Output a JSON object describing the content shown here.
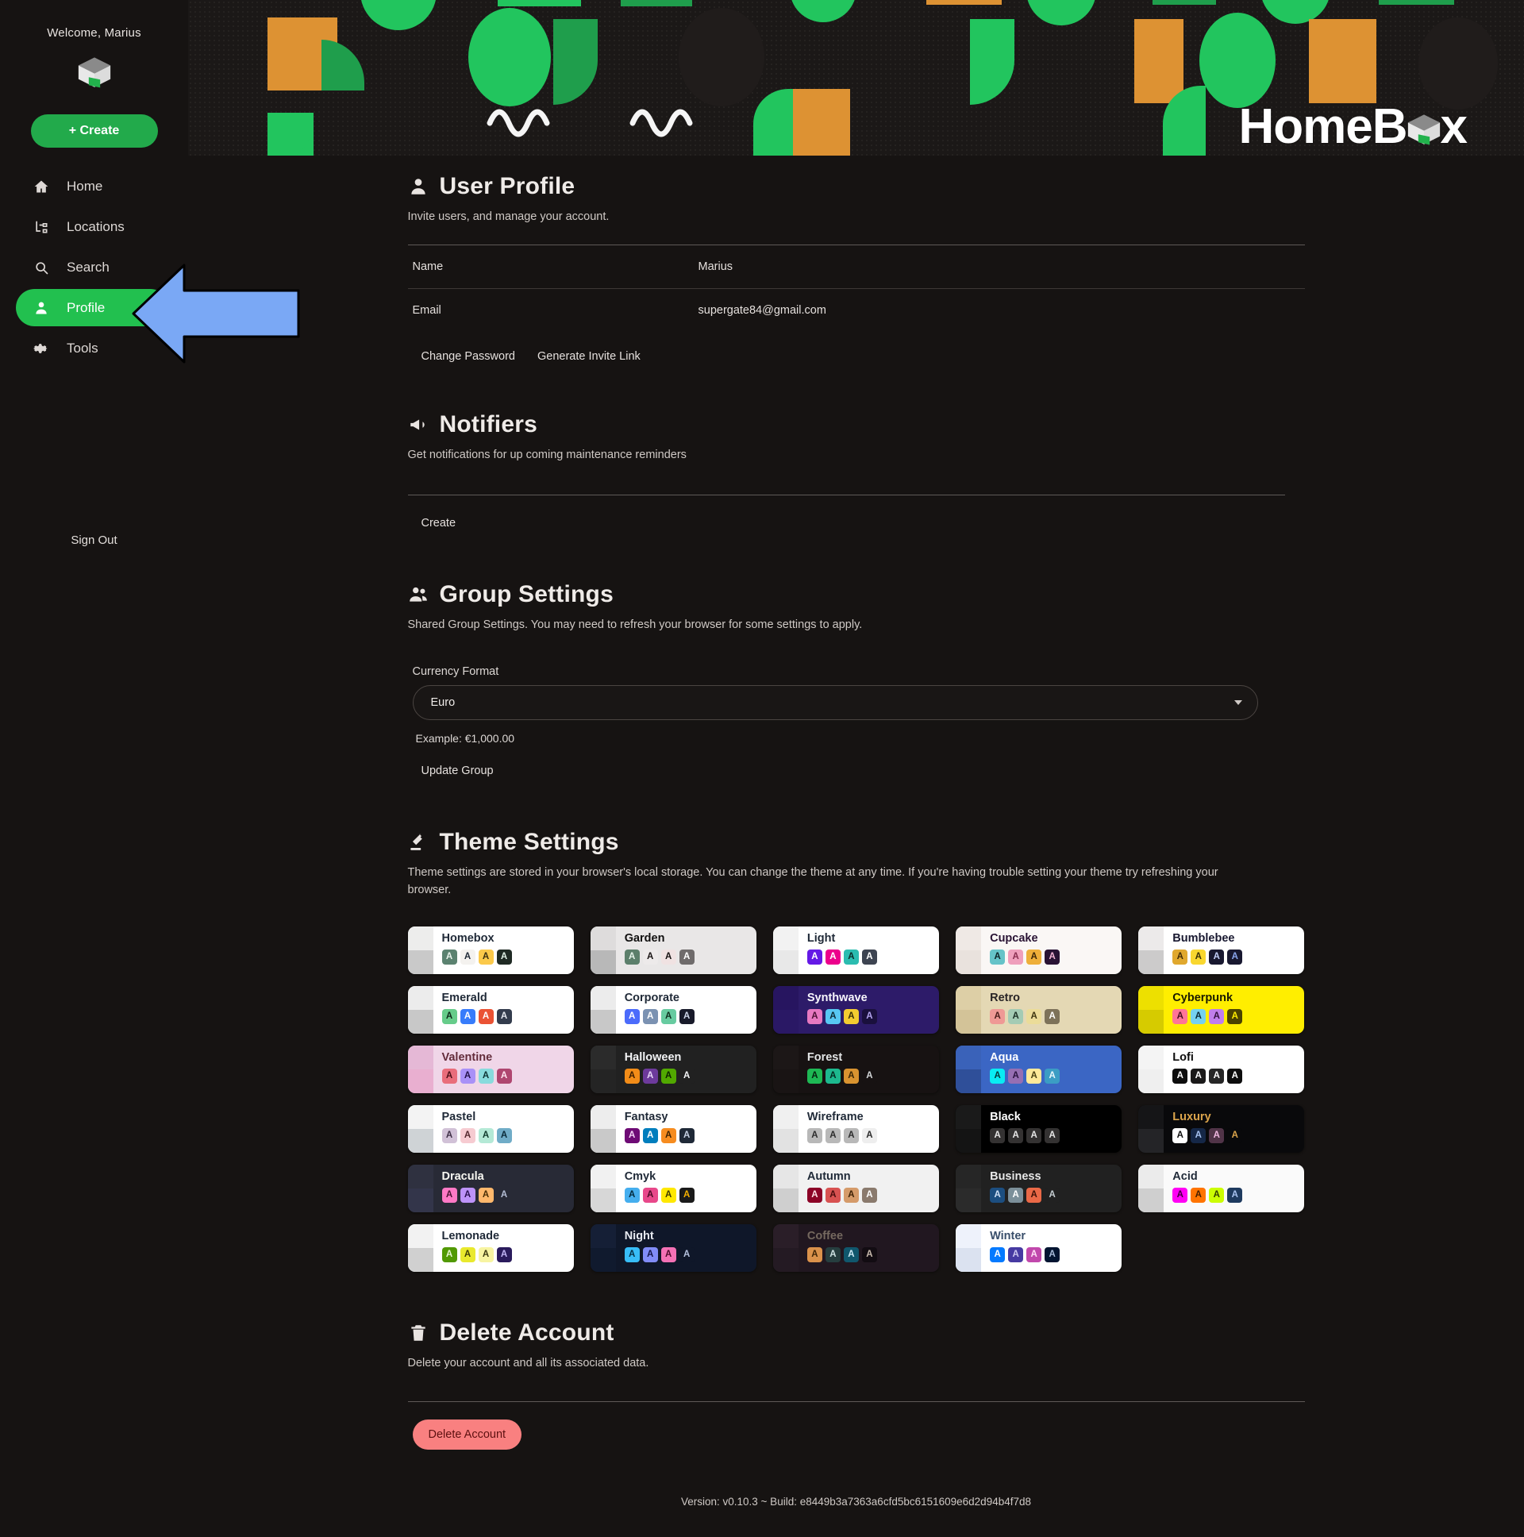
{
  "app": {
    "logo_text_left": "HomeB",
    "logo_text_right": "x",
    "logo_icon": "box-icon"
  },
  "sidebar": {
    "welcome": "Welcome, Marius",
    "brand_icon": "homebox-box-icon",
    "create_label": "+ Create",
    "items": [
      {
        "label": "Home",
        "icon": "home-icon",
        "active": false
      },
      {
        "label": "Locations",
        "icon": "locations-tree-icon",
        "active": false
      },
      {
        "label": "Search",
        "icon": "search-icon",
        "active": false
      },
      {
        "label": "Profile",
        "icon": "person-icon",
        "active": true
      },
      {
        "label": "Tools",
        "icon": "gear-icon",
        "active": false
      }
    ],
    "sign_out": "Sign Out"
  },
  "annotation": {
    "arrow_color": "#7aa8f5",
    "points_to": "Profile"
  },
  "user_profile": {
    "title": "User Profile",
    "icon": "person-icon",
    "subtitle": "Invite users, and manage your account.",
    "rows": [
      {
        "key": "Name",
        "value": "Marius"
      },
      {
        "key": "Email",
        "value": "supergate84@gmail.com"
      }
    ],
    "buttons": [
      "Change Password",
      "Generate Invite Link"
    ]
  },
  "notifiers": {
    "title": "Notifiers",
    "icon": "megaphone-icon",
    "subtitle": "Get notifications for up coming maintenance reminders",
    "create_label": "Create"
  },
  "group_settings": {
    "title": "Group Settings",
    "icon": "people-icon",
    "subtitle": "Shared Group Settings. You may need to refresh your browser for some settings to apply.",
    "currency_label": "Currency Format",
    "currency_value": "Euro",
    "currency_options": [
      "Euro"
    ],
    "example": "Example: €1,000.00",
    "update_label": "Update Group"
  },
  "theme_settings": {
    "title": "Theme Settings",
    "icon": "paint-dropper-icon",
    "subtitle": "Theme settings are stored in your browser's local storage. You can change the theme at any time. If you're having trouble setting your theme try refreshing your browser.",
    "swatch_letter": "A",
    "themes": [
      {
        "name": "Homebox",
        "bg": "#ffffff",
        "strip_top": "#ededec",
        "strip_bottom": "#c9c9c9",
        "text": "#1f2937",
        "swatches": [
          [
            "#5b8270",
            "#e8f3ec"
          ],
          [
            "#f4f2ef",
            "#1f2937"
          ],
          [
            "#fbc94a",
            "#3b3011"
          ],
          [
            "#1f2a24",
            "#dff0e5"
          ]
        ]
      },
      {
        "name": "Garden",
        "bg": "#e9e7e7",
        "strip_top": "#dedcdc",
        "strip_bottom": "#b8b8b8",
        "text": "#100f0f",
        "swatches": [
          [
            "#5c7f6b",
            "#e6f3ea"
          ],
          [
            "#edeaea",
            "#171212"
          ],
          [
            "#f0e2e2",
            "#171212"
          ],
          [
            "#6f6b6b",
            "#ffffff"
          ]
        ]
      },
      {
        "name": "Light",
        "bg": "#ffffff",
        "strip_top": "#f2f2f2",
        "strip_bottom": "#e8e8e8",
        "text": "#1f2937",
        "swatches": [
          [
            "#6419e6",
            "#ffffff"
          ],
          [
            "#ec008c",
            "#ffffff"
          ],
          [
            "#2bbcb0",
            "#0d2b28"
          ],
          [
            "#3d4451",
            "#ffffff"
          ]
        ]
      },
      {
        "name": "Cupcake",
        "bg": "#faf7f5",
        "strip_top": "#efe9e5",
        "strip_bottom": "#e9e2dd",
        "text": "#291334",
        "swatches": [
          [
            "#65c3c8",
            "#0d2427"
          ],
          [
            "#ef9fbc",
            "#8a2e50"
          ],
          [
            "#eeaf3a",
            "#3a2608"
          ],
          [
            "#291334",
            "#f5b6d6"
          ]
        ]
      },
      {
        "name": "Bumblebee",
        "bg": "#ffffff",
        "strip_top": "#eceaea",
        "strip_bottom": "#cccbcb",
        "text": "#181830",
        "swatches": [
          [
            "#e0a82e",
            "#412c07"
          ],
          [
            "#f9d72f",
            "#3a3107"
          ],
          [
            "#181830",
            "#c3cffa"
          ],
          [
            "#181830",
            "#8ba7f0"
          ]
        ]
      },
      {
        "name": "Emerald",
        "bg": "#ffffff",
        "strip_top": "#ececec",
        "strip_bottom": "#c8c8c8",
        "text": "#1f2937",
        "swatches": [
          [
            "#66cc8a",
            "#0f2a1a"
          ],
          [
            "#377cfb",
            "#ffffff"
          ],
          [
            "#ea5234",
            "#ffffff"
          ],
          [
            "#333c4d",
            "#e4e7ee"
          ]
        ]
      },
      {
        "name": "Corporate",
        "bg": "#ffffff",
        "strip_top": "#ececec",
        "strip_bottom": "#c8c8c8",
        "text": "#1f2937",
        "swatches": [
          [
            "#4b6bfb",
            "#ffffff"
          ],
          [
            "#7b92b2",
            "#ffffff"
          ],
          [
            "#67cba0",
            "#10301f"
          ],
          [
            "#181a2a",
            "#cfd6ea"
          ]
        ]
      },
      {
        "name": "Synthwave",
        "bg": "#2d1b69",
        "strip_top": "#271560",
        "strip_bottom": "#2a1865",
        "text": "#f9f7fd",
        "swatches": [
          [
            "#e779c1",
            "#4b1034"
          ],
          [
            "#58c7f3",
            "#0e2a36"
          ],
          [
            "#f3cc30",
            "#3a3007"
          ],
          [
            "#1a103d",
            "#b3a4ef"
          ]
        ]
      },
      {
        "name": "Retro",
        "bg": "#e4d8b4",
        "strip_top": "#ddcfa6",
        "strip_bottom": "#d3c398",
        "text": "#282425",
        "swatches": [
          [
            "#ef9995",
            "#4a1c1a"
          ],
          [
            "#a4cbb4",
            "#1c3026"
          ],
          [
            "#ebdc99",
            "#3c3410"
          ],
          [
            "#7d7259",
            "#ffffff"
          ]
        ]
      },
      {
        "name": "Cyberpunk",
        "bg": "#ffee00",
        "strip_top": "#ede000",
        "strip_bottom": "#d6cb00",
        "text": "#1a1a00",
        "swatches": [
          [
            "#ff7598",
            "#4a0f22"
          ],
          [
            "#75d1f0",
            "#0b2b38"
          ],
          [
            "#c07eec",
            "#33113f"
          ],
          [
            "#4a4200",
            "#ffee00"
          ]
        ]
      },
      {
        "name": "Valentine",
        "bg": "#f0d6e8",
        "strip_top": "#e5b8d6",
        "strip_bottom": "#e9afd0",
        "text": "#632c3b",
        "swatches": [
          [
            "#e96d7b",
            "#4d1018"
          ],
          [
            "#a991f7",
            "#23114a"
          ],
          [
            "#88dbdd",
            "#0e3334"
          ],
          [
            "#af4670",
            "#ffe4ef"
          ]
        ]
      },
      {
        "name": "Halloween",
        "bg": "#212121",
        "strip_top": "#2b2b2b",
        "strip_bottom": "#242424",
        "text": "#f3f4f6",
        "swatches": [
          [
            "#f28c18",
            "#3c1d00"
          ],
          [
            "#6d3a9c",
            "#e6d6f7"
          ],
          [
            "#51a800",
            "#0e2400"
          ],
          [
            "#212121",
            "#f3f4f6"
          ]
        ]
      },
      {
        "name": "Forest",
        "bg": "#171212",
        "strip_top": "#1c1717",
        "strip_bottom": "#191414",
        "text": "#e3e5e6",
        "swatches": [
          [
            "#1eb854",
            "#04230f"
          ],
          [
            "#1db88e",
            "#042b20"
          ],
          [
            "#d99330",
            "#3b2706"
          ],
          [
            "#171212",
            "#d3d6d8"
          ]
        ]
      },
      {
        "name": "Aqua",
        "bg": "#3b66c4",
        "strip_top": "#3a62b9",
        "strip_bottom": "#2f4f99",
        "text": "#ffffff",
        "swatches": [
          [
            "#09ecf3",
            "#043a3c"
          ],
          [
            "#966fb3",
            "#2a1440"
          ],
          [
            "#ffe999",
            "#4a4012"
          ],
          [
            "#3b9dc4",
            "#e7f6fb"
          ]
        ]
      },
      {
        "name": "Lofi",
        "bg": "#ffffff",
        "strip_top": "#f4f4f4",
        "strip_bottom": "#efefef",
        "text": "#0d0d0d",
        "swatches": [
          [
            "#0d0d0d",
            "#ffffff"
          ],
          [
            "#1a1919",
            "#ffffff"
          ],
          [
            "#262626",
            "#ffffff"
          ],
          [
            "#0d0d0d",
            "#ffffff"
          ]
        ]
      },
      {
        "name": "Pastel",
        "bg": "#ffffff",
        "strip_top": "#f3f3f3",
        "strip_bottom": "#cfd3d6",
        "text": "#1f2937",
        "swatches": [
          [
            "#d1c1d7",
            "#3f2f46"
          ],
          [
            "#f6cbd1",
            "#54292f"
          ],
          [
            "#b4e9d6",
            "#103a2c"
          ],
          [
            "#70acc7",
            "#0b2a38"
          ]
        ]
      },
      {
        "name": "Fantasy",
        "bg": "#ffffff",
        "strip_top": "#ededed",
        "strip_bottom": "#c9c9c9",
        "text": "#1f2937",
        "swatches": [
          [
            "#6e0b75",
            "#f5d6f7"
          ],
          [
            "#007ebd",
            "#ffffff"
          ],
          [
            "#f68c1f",
            "#3d2203"
          ],
          [
            "#1f2937",
            "#c6d1e4"
          ]
        ]
      },
      {
        "name": "Wireframe",
        "bg": "#ffffff",
        "strip_top": "#f0f0f0",
        "strip_bottom": "#e2e2e2",
        "text": "#1f2937",
        "swatches": [
          [
            "#b8b8b8",
            "#2b2b2b"
          ],
          [
            "#b8b8b8",
            "#2b2b2b"
          ],
          [
            "#b8b8b8",
            "#2b2b2b"
          ],
          [
            "#eeeeee",
            "#2b2b2b"
          ]
        ]
      },
      {
        "name": "Black",
        "bg": "#000000",
        "strip_top": "#1a1a1a",
        "strip_bottom": "#141414",
        "text": "#ffffff",
        "swatches": [
          [
            "#343232",
            "#e7e7e7"
          ],
          [
            "#343232",
            "#e7e7e7"
          ],
          [
            "#343232",
            "#e7e7e7"
          ],
          [
            "#343232",
            "#e7e7e7"
          ]
        ]
      },
      {
        "name": "Luxury",
        "bg": "#09090b",
        "strip_top": "#151517",
        "strip_bottom": "#242427",
        "text": "#dca54c",
        "swatches": [
          [
            "#ffffff",
            "#0c0c0c"
          ],
          [
            "#152747",
            "#a7c2f0"
          ],
          [
            "#513448",
            "#f0b8e0"
          ],
          [
            "#09090b",
            "#dca54c"
          ]
        ]
      },
      {
        "name": "Dracula",
        "bg": "#282a36",
        "strip_top": "#2f3140",
        "strip_bottom": "#33354a",
        "text": "#f8f8f2",
        "swatches": [
          [
            "#ff79c6",
            "#4c1434"
          ],
          [
            "#bd93f9",
            "#2b1251"
          ],
          [
            "#ffb86c",
            "#4a2e06"
          ],
          [
            "#282a36",
            "#b4bdd4"
          ]
        ]
      },
      {
        "name": "Cmyk",
        "bg": "#ffffff",
        "strip_top": "#f1f1f1",
        "strip_bottom": "#d7d7d7",
        "text": "#1f2937",
        "swatches": [
          [
            "#45aeee",
            "#04293c"
          ],
          [
            "#e8488a",
            "#4c0b26"
          ],
          [
            "#ffe800",
            "#3f3b00"
          ],
          [
            "#1a1a1a",
            "#f4b000"
          ]
        ]
      },
      {
        "name": "Autumn",
        "bg": "#f1f1f1",
        "strip_top": "#e6e6e6",
        "strip_bottom": "#cfcfcf",
        "text": "#1f2937",
        "swatches": [
          [
            "#8c0327",
            "#ffe3e8"
          ],
          [
            "#d85251",
            "#4a0d0d"
          ],
          [
            "#d59b6a",
            "#3e2207"
          ],
          [
            "#8a7a6d",
            "#ffffff"
          ]
        ]
      },
      {
        "name": "Business",
        "bg": "#212121",
        "strip_top": "#262626",
        "strip_bottom": "#2b2b2b",
        "text": "#e9e9e9",
        "swatches": [
          [
            "#1c4e80",
            "#cfe0f5"
          ],
          [
            "#7c909a",
            "#ffffff"
          ],
          [
            "#ea6947",
            "#3d1207"
          ],
          [
            "#212121",
            "#c5cdd2"
          ]
        ]
      },
      {
        "name": "Acid",
        "bg": "#fafafa",
        "strip_top": "#ebebeb",
        "strip_bottom": "#cfcfcf",
        "text": "#1f2937",
        "swatches": [
          [
            "#ff00f4",
            "#42003f"
          ],
          [
            "#ff7400",
            "#431e00"
          ],
          [
            "#cbfd03",
            "#333f00"
          ],
          [
            "#1e3a5f",
            "#a9c3f0"
          ]
        ]
      },
      {
        "name": "Lemonade",
        "bg": "#ffffff",
        "strip_top": "#f2f2f2",
        "strip_bottom": "#d0d0d0",
        "text": "#1f2937",
        "swatches": [
          [
            "#519903",
            "#e8f7d2"
          ],
          [
            "#e9e92e",
            "#3d3d06"
          ],
          [
            "#f7f4a2",
            "#3d3b12"
          ],
          [
            "#2a1b5c",
            "#c2b6f5"
          ]
        ]
      },
      {
        "name": "Night",
        "bg": "#0f1729",
        "strip_top": "#151f36",
        "strip_bottom": "#101a2e",
        "text": "#e7eaf0",
        "swatches": [
          [
            "#38bdf8",
            "#062f45"
          ],
          [
            "#818cf8",
            "#13154a"
          ],
          [
            "#f471b5",
            "#4d0b2a"
          ],
          [
            "#0f1729",
            "#b4c1dd"
          ]
        ]
      },
      {
        "name": "Coffee",
        "bg": "#211720",
        "strip_top": "#2a1e28",
        "strip_bottom": "#241a23",
        "text": "#75695f",
        "swatches": [
          [
            "#db924b",
            "#3e2406"
          ],
          [
            "#263e3f",
            "#cfe3e3"
          ],
          [
            "#10576d",
            "#cdeaf5"
          ],
          [
            "#120c12",
            "#c9bbae"
          ]
        ]
      },
      {
        "name": "Winter",
        "bg": "#ffffff",
        "strip_top": "#eef2fb",
        "strip_bottom": "#dbe2f0",
        "text": "#394e6a",
        "swatches": [
          [
            "#047aff",
            "#ffffff"
          ],
          [
            "#463aa2",
            "#cdc7f0"
          ],
          [
            "#c148ac",
            "#ffe0f6"
          ],
          [
            "#021431",
            "#a9bcdb"
          ]
        ]
      }
    ]
  },
  "delete_account": {
    "title": "Delete Account",
    "icon": "trash-icon",
    "subtitle": "Delete your account and all its associated data.",
    "button": "Delete Account"
  },
  "footer": {
    "version": "Version: v0.10.3 ~ Build: e8449b3a7363a6cfd5bc6151609e6d2d94b4f7d8"
  }
}
